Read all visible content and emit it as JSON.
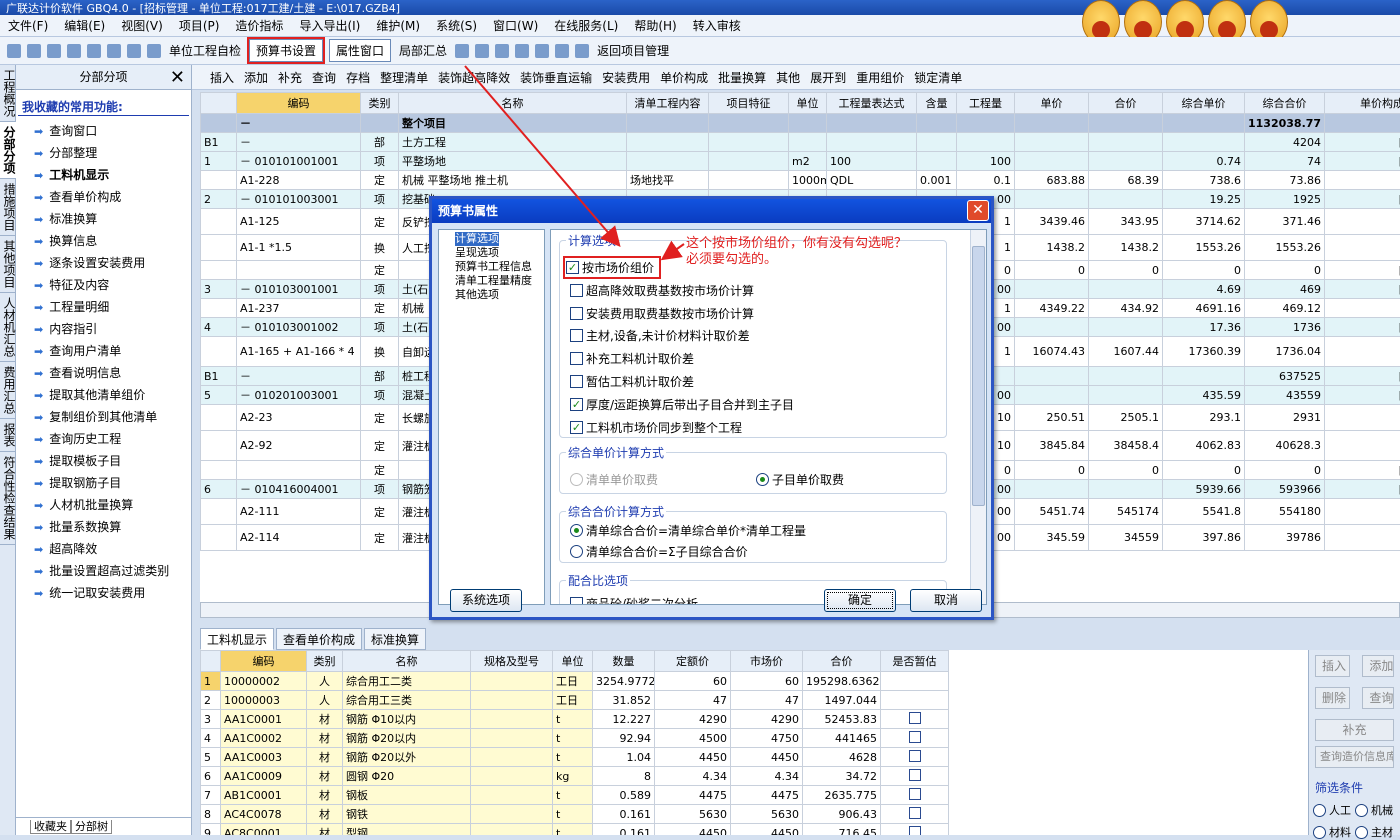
{
  "titlebar": {
    "text": "广联达计价软件 GBQ4.0 - [招标管理 - 单位工程:017工建/土建 - E:\\017.GZB4]"
  },
  "menu": [
    "文件(F)",
    "编辑(E)",
    "视图(V)",
    "项目(P)",
    "造价指标",
    "导入导出(I)",
    "维护(M)",
    "系统(S)",
    "窗口(W)",
    "在线服务(L)",
    "帮助(H)",
    "转入审核"
  ],
  "toolbar1": {
    "unit_project_label": "单位工程自检",
    "budget_settings": "预算书设置",
    "property_window": "属性窗口",
    "partial_summary": "局部汇总",
    "return_project": "返回项目管理"
  },
  "toolbar2": [
    "插入",
    "添加",
    "补充",
    "查询",
    "存档",
    "整理清单",
    "装饰超高降效",
    "装饰垂直运输",
    "安装费用",
    "单价构成",
    "批量换算",
    "其他",
    "展开到",
    "重用组价",
    "锁定清单"
  ],
  "vtabs": [
    "工程概况",
    "分部分项",
    "措施项目",
    "其他项目",
    "人材机汇总",
    "费用汇总",
    "报表",
    "符合性检查结果"
  ],
  "left_panel": {
    "title": "分部分项",
    "favorites_title": "我收藏的常用功能:",
    "items": [
      "查询窗口",
      "分部整理",
      "工料机显示",
      "查看单价构成",
      "标准换算",
      "换算信息",
      "逐条设置安装费用",
      "特征及内容",
      "工程量明细",
      "内容指引",
      "查询用户清单",
      "查看说明信息",
      "提取其他清单组价",
      "复制组价到其他清单",
      "查询历史工程",
      "提取模板子目",
      "提取钢筋子目",
      "人材机批量换算",
      "批量系数换算",
      "超高降效",
      "批量设置超高过滤类别",
      "统一记取安装费用"
    ],
    "bottom_tabs": [
      "收藏夹",
      "分部树"
    ]
  },
  "main_grid": {
    "headers": [
      "",
      "编码",
      "类别",
      "名称",
      "清单工程内容",
      "项目特征",
      "单位",
      "工程量表达式",
      "含量",
      "工程量",
      "单价",
      "合价",
      "综合单价",
      "综合合价",
      "单价构成文"
    ],
    "rows": [
      [
        "",
        "－",
        "",
        "整个项目",
        "",
        "",
        "",
        "",
        "",
        "",
        "",
        "",
        "",
        "1132038.77",
        ""
      ],
      [
        "B1",
        "－",
        "部",
        "土方工程",
        "",
        "",
        "",
        "",
        "",
        "",
        "",
        "",
        "",
        "4204",
        "[一般土建"
      ],
      [
        "1",
        "－ 010101001001",
        "项",
        "平整场地",
        "",
        "",
        "m2",
        "100",
        "",
        "100",
        "",
        "",
        "0.74",
        "74",
        "[一般土建"
      ],
      [
        "",
        "A1-228",
        "定",
        "机械 平整场地 推土机",
        "场地找平",
        "",
        "1000m2",
        "QDL",
        "0.001",
        "0.1",
        "683.88",
        "68.39",
        "738.6",
        "73.86",
        "土石"
      ],
      [
        "2",
        "－ 010101003001",
        "项",
        "挖基础",
        "",
        "",
        "",
        "",
        "",
        "00",
        "",
        "",
        "19.25",
        "1925",
        "[一般土建"
      ],
      [
        "",
        "A1-125",
        "定",
        "反铲挖二类土",
        "",
        "",
        "",
        "",
        "",
        "1",
        "3439.46",
        "343.95",
        "3714.62",
        "371.46",
        "土石"
      ],
      [
        "",
        "A1-1 *1.5",
        "换",
        "人工挖械挖土",
        "",
        "",
        "",
        "",
        "",
        "1",
        "1438.2",
        "1438.2",
        "1553.26",
        "1553.26",
        "土石"
      ],
      [
        "",
        "",
        "定",
        "",
        "",
        "",
        "",
        "",
        "",
        "0",
        "0",
        "0",
        "0",
        "0",
        "[一般土建"
      ],
      [
        "3",
        "－ 010103001001",
        "项",
        "土(石",
        "",
        "",
        "",
        "",
        "",
        "00",
        "",
        "",
        "4.69",
        "469",
        "[一般土建"
      ],
      [
        "",
        "A1-237",
        "定",
        "机械",
        "",
        "",
        "",
        "",
        "",
        "1",
        "4349.22",
        "434.92",
        "4691.16",
        "469.12",
        "土石"
      ],
      [
        "4",
        "－ 010103001002",
        "项",
        "土(石",
        "",
        "",
        "",
        "",
        "",
        "00",
        "",
        "",
        "17.36",
        "1736",
        "[一般土建"
      ],
      [
        "",
        "A1-165 + A1-166 * 4",
        "换",
        "自卸运距",
        "",
        "",
        "",
        "",
        "",
        "1",
        "16074.43",
        "1607.44",
        "17360.39",
        "1736.04",
        "土石"
      ],
      [
        "B1",
        "－",
        "部",
        "桩工程",
        "",
        "",
        "",
        "",
        "",
        "",
        "",
        "",
        "",
        "637525",
        "[一般土建"
      ],
      [
        "5",
        "－ 010201003001",
        "项",
        "混凝土",
        "",
        "",
        "",
        "",
        "",
        "00",
        "",
        "",
        "435.59",
        "43559",
        "[一般土建"
      ],
      [
        "",
        "A2-23",
        "定",
        "长螺旋土 桩",
        "",
        "",
        "",
        "",
        "",
        "10",
        "250.51",
        "2505.1",
        "293.1",
        "2931",
        "灌注"
      ],
      [
        "",
        "A2-92",
        "定",
        "灌注桩",
        "",
        "",
        "",
        "",
        "",
        "10",
        "3845.84",
        "38458.4",
        "4062.83",
        "40628.3",
        "灌注"
      ],
      [
        "",
        "",
        "定",
        "",
        "",
        "",
        "",
        "",
        "",
        "0",
        "0",
        "0",
        "0",
        "0",
        "[一般土建"
      ],
      [
        "6",
        "－ 010416004001",
        "项",
        "钢筋笼",
        "",
        "",
        "",
        "",
        "",
        "00",
        "",
        "",
        "5939.66",
        "593966",
        "[一般土建"
      ],
      [
        "",
        "A2-111",
        "定",
        "灌注桩",
        "",
        "",
        "",
        "",
        "",
        "00",
        "5451.74",
        "545174",
        "5541.8",
        "554180",
        "灌注"
      ],
      [
        "",
        "A2-114",
        "定",
        "灌注桩以内",
        "",
        "",
        "",
        "",
        "",
        "00",
        "345.59",
        "34559",
        "397.86",
        "39786",
        "灌注"
      ]
    ]
  },
  "bottom_tabs": [
    "工料机显示",
    "查看单价构成",
    "标准换算"
  ],
  "bottom_grid": {
    "headers": [
      "",
      "编码",
      "类别",
      "名称",
      "规格及型号",
      "单位",
      "数量",
      "定额价",
      "市场价",
      "合价",
      "是否暂估"
    ],
    "rows": [
      [
        "1",
        "10000002",
        "人",
        "综合用工二类",
        "",
        "工日",
        "3254.9772",
        "60",
        "60",
        "195298.6362",
        ""
      ],
      [
        "2",
        "10000003",
        "人",
        "综合用工三类",
        "",
        "工日",
        "31.852",
        "47",
        "47",
        "1497.044",
        ""
      ],
      [
        "3",
        "AA1C0001",
        "材",
        "钢筋 Φ10以内",
        "",
        "t",
        "12.227",
        "4290",
        "4290",
        "52453.83",
        "□"
      ],
      [
        "4",
        "AA1C0002",
        "材",
        "钢筋 Φ20以内",
        "",
        "t",
        "92.94",
        "4500",
        "4750",
        "441465",
        "□"
      ],
      [
        "5",
        "AA1C0003",
        "材",
        "钢筋 Φ20以外",
        "",
        "t",
        "1.04",
        "4450",
        "4450",
        "4628",
        "□"
      ],
      [
        "6",
        "AA1C0009",
        "材",
        "圆钢 Φ20",
        "",
        "kg",
        "8",
        "4.34",
        "4.34",
        "34.72",
        "□"
      ],
      [
        "7",
        "AB1C0001",
        "材",
        "钢板",
        "",
        "t",
        "0.589",
        "4475",
        "4475",
        "2635.775",
        "□"
      ],
      [
        "8",
        "AC4C0078",
        "材",
        "钢铁",
        "",
        "t",
        "0.161",
        "5630",
        "5630",
        "906.43",
        "□"
      ],
      [
        "9",
        "AC8C0001",
        "材",
        "型钢",
        "",
        "t",
        "0.161",
        "4450",
        "4450",
        "716.45",
        "□"
      ]
    ]
  },
  "right_panel": {
    "insert": "插入",
    "add": "添加",
    "delete": "删除",
    "query": "查询",
    "supplement": "补充",
    "query_price": "查询造价信息库",
    "filter_title": "筛选条件",
    "labor": "人工",
    "machine": "机械",
    "material": "材料",
    "main": "主材"
  },
  "dialog": {
    "title": "预算书属性",
    "tree": [
      "计算选项",
      "呈现选项",
      "预算书工程信息",
      "清单工程量精度",
      "其他选项"
    ],
    "group1_title": "计算选项",
    "checks": [
      {
        "label": "按市场价组价",
        "checked": true
      },
      {
        "label": "超高降效取费基数按市场价计算",
        "checked": false
      },
      {
        "label": "安装费用取费基数按市场价计算",
        "checked": false
      },
      {
        "label": "主材,设备,未计价材料计取价差",
        "checked": false
      },
      {
        "label": "补充工料机计取价差",
        "checked": false
      },
      {
        "label": "暂估工料机计取价差",
        "checked": false
      },
      {
        "label": "厚度/运距换算后带出子目合并到主子目",
        "checked": true
      },
      {
        "label": "工料机市场价同步到整个工程",
        "checked": true
      }
    ],
    "group2_title": "综合单价计算方式",
    "g2_opt1": "清单单价取费",
    "g2_opt2": "子目单价取费",
    "group3_title": "综合合价计算方式",
    "g3_opt1": "清单综合合价=清单综合单价*清单工程量",
    "g3_opt2": "清单综合合价=Σ子目综合合价",
    "group4_title": "配合比选项",
    "g4_opt1": "商品砼/砂浆二次分析",
    "sys_btn": "系统选项",
    "ok": "确定",
    "cancel": "取消"
  },
  "annotation": {
    "line1": "这个按市场价组价，你有没有勾选呢？",
    "line2": "必须要勾选的。"
  },
  "colors": {
    "annotation": "#e02020",
    "title_blue": "#1254e0"
  }
}
